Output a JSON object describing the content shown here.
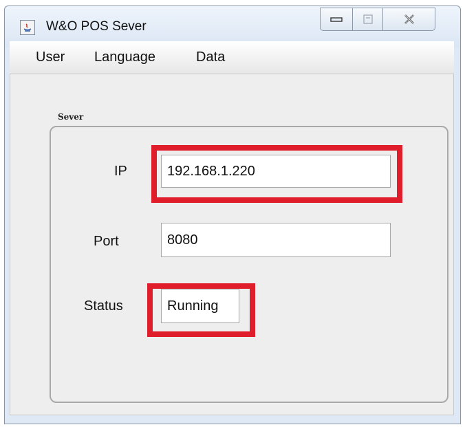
{
  "window": {
    "title": "W&O POS Sever",
    "icons": {
      "app": "java-app-icon",
      "minimize": "minimize-icon",
      "maximize": "maximize-icon",
      "close": "close-icon"
    }
  },
  "menu": {
    "items": [
      "User",
      "Language",
      "Data"
    ]
  },
  "server_group": {
    "title": "Sever",
    "ip": {
      "label": "IP",
      "value": "192.168.1.220"
    },
    "port": {
      "label": "Port",
      "value": "8080"
    },
    "status": {
      "label": "Status",
      "value": "Running"
    }
  },
  "colors": {
    "highlight": "#e01e2b",
    "window_bg": "#eeeeee"
  }
}
